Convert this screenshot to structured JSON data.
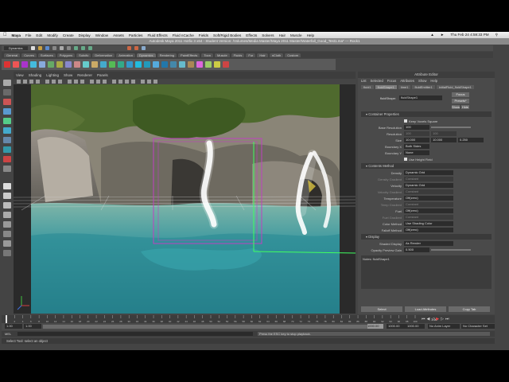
{
  "menubar": {
    "app": "Maya",
    "items": [
      "File",
      "Edit",
      "Modify",
      "Create",
      "Display",
      "Window",
      "Assets",
      "Particles",
      "Fluid Effects",
      "Fluid nCache",
      "Fields",
      "Soft/Rigid Bodies",
      "Effects",
      "Solvers",
      "Hair",
      "Muscle",
      "Help"
    ],
    "clock": "Thu Feb 24  4:59:33 PM"
  },
  "window_title": "Autodesk Maya 2011 Hotfix 3 x64 - Student Version: /Volumes/Media Master/Maya 2011 Master/Waterfall_Good_Test1.ma*  ---  Rock1",
  "statusline": {
    "mode": "Dynamics"
  },
  "shelf": {
    "tabs": [
      "General",
      "Curves",
      "Surfaces",
      "Polygons",
      "Subdiv",
      "Deformation",
      "Animation",
      "Dynamics",
      "Rendering",
      "PaintEffects",
      "Toon",
      "Muscle",
      "Fluids",
      "Fur",
      "Hair",
      "nCloth",
      "Custom"
    ],
    "active": "Dynamics"
  },
  "viewport": {
    "menu": [
      "View",
      "Shading",
      "Lighting",
      "Show",
      "Renderer",
      "Panels"
    ]
  },
  "attribute_editor": {
    "title": "Attribute Editor",
    "menu": [
      "List",
      "Selected",
      "Focus",
      "Attributes",
      "Show",
      "Help"
    ],
    "tabs": [
      "fluid1",
      "fluidShape1",
      "time1",
      "fluidEmitter1",
      "initialFluid_fluidShape1"
    ],
    "node_label": "fluidShape:",
    "node_value": "fluidShape1",
    "buttons": {
      "focus": "Focus",
      "presets": "Presets*",
      "show": "Show",
      "hide": "Hide"
    },
    "sections": {
      "container": "Container Properties",
      "contents": "Contents Method",
      "display": "Display"
    },
    "keep_voxels_square": "Keep Voxels Square",
    "base_resolution": {
      "label": "Base Resolution",
      "value": "100"
    },
    "resolution": {
      "label": "Resolution",
      "x": "100",
      "y": "100"
    },
    "size": {
      "label": "Size",
      "x": "10.000",
      "y": "10.000",
      "z": "0.250"
    },
    "boundary_x": {
      "label": "Boundary X",
      "value": "Both Sides"
    },
    "boundary_y": {
      "label": "Boundary Y",
      "value": "None"
    },
    "use_height_field": "Use Height Field",
    "contents": [
      {
        "label": "Density",
        "value": "Dynamic Grid"
      },
      {
        "label": "Density Gradient",
        "value": "Constant"
      },
      {
        "label": "Velocity",
        "value": "Dynamic Grid"
      },
      {
        "label": "Velocity Gradient",
        "value": "Constant"
      },
      {
        "label": "Temperature",
        "value": "Off(zero)"
      },
      {
        "label": "Temp Gradient",
        "value": "Constant"
      },
      {
        "label": "Fuel",
        "value": "Off(zero)"
      },
      {
        "label": "Fuel Gradient",
        "value": "Constant"
      },
      {
        "label": "Color Method",
        "value": "Use Shading Color"
      },
      {
        "label": "Falloff Method",
        "value": "Off(zero)"
      }
    ],
    "shaded_display": {
      "label": "Shaded Display",
      "value": "As Render"
    },
    "opacity_preview_gain": {
      "label": "Opacity Preview Gain",
      "value": "0.500"
    },
    "notes": "Notes: fluidShape1",
    "bottom_buttons": [
      "Select",
      "Load Attributes",
      "Copy Tab"
    ]
  },
  "timeline": {
    "ticks": [
      "1",
      "2",
      "4",
      "6",
      "8",
      "10",
      "12",
      "14",
      "16",
      "18",
      "20",
      "22",
      "24",
      "26",
      "28",
      "30",
      "32",
      "34",
      "36",
      "38",
      "40",
      "42",
      "44",
      "46",
      "48",
      "50",
      "52",
      "54",
      "56",
      "58",
      "60",
      "62",
      "64",
      "66",
      "68",
      "70",
      "72",
      "74",
      "76",
      "78",
      "80",
      "82",
      "84",
      "86",
      "88",
      "90",
      "92",
      "94",
      "96",
      "98",
      "100"
    ],
    "current_frame": "1.00"
  },
  "range": {
    "start": "1.00",
    "inner_start": "1.00",
    "inner_end": "1000.00",
    "end": "1000.00",
    "end2": "1000.00",
    "anim_layer": "No Anim Layer",
    "character_set": "No Character Set"
  },
  "command_line": {
    "label": "MEL",
    "feedback": "Press the ESC key to stop playback."
  },
  "help_line": "Select Tool: select an object",
  "colors": {
    "bg": "#444444",
    "selection": "#c040c0",
    "manip_green": "#40ff60"
  }
}
